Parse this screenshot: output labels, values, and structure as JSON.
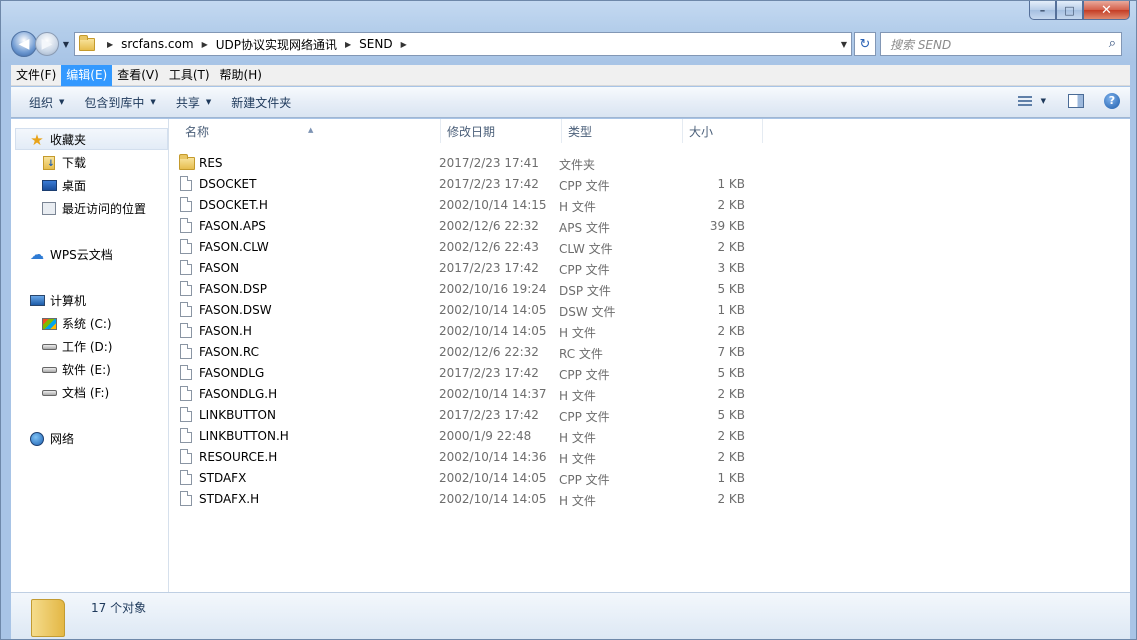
{
  "caption": {
    "min": "–",
    "max": "□",
    "close": "✕"
  },
  "address": {
    "crumbs": [
      "srcfans.com",
      "UDP协议实现网络通讯",
      "SEND"
    ],
    "search_placeholder": "搜索 SEND"
  },
  "menu": [
    "文件(F)",
    "编辑(E)",
    "查看(V)",
    "工具(T)",
    "帮助(H)"
  ],
  "toolbar": {
    "organize": "组织",
    "include": "包含到库中",
    "share": "共享",
    "new_folder": "新建文件夹"
  },
  "nav": {
    "favorites": "收藏夹",
    "downloads": "下载",
    "desktop": "桌面",
    "recent": "最近访问的位置",
    "wps": "WPS云文档",
    "computer": "计算机",
    "drive_c": "系统 (C:)",
    "drive_d": "工作 (D:)",
    "drive_e": "软件 (E:)",
    "drive_f": "文档 (F:)",
    "network": "网络"
  },
  "columns": {
    "name": "名称",
    "date": "修改日期",
    "type": "类型",
    "size": "大小"
  },
  "files": [
    {
      "name": "RES",
      "date": "2017/2/23 17:41",
      "type": "文件夹",
      "size": "",
      "folder": true
    },
    {
      "name": "DSOCKET",
      "date": "2017/2/23 17:42",
      "type": "CPP 文件",
      "size": "1 KB"
    },
    {
      "name": "DSOCKET.H",
      "date": "2002/10/14 14:15",
      "type": "H 文件",
      "size": "2 KB"
    },
    {
      "name": "FASON.APS",
      "date": "2002/12/6 22:32",
      "type": "APS 文件",
      "size": "39 KB"
    },
    {
      "name": "FASON.CLW",
      "date": "2002/12/6 22:43",
      "type": "CLW 文件",
      "size": "2 KB"
    },
    {
      "name": "FASON",
      "date": "2017/2/23 17:42",
      "type": "CPP 文件",
      "size": "3 KB"
    },
    {
      "name": "FASON.DSP",
      "date": "2002/10/16 19:24",
      "type": "DSP 文件",
      "size": "5 KB"
    },
    {
      "name": "FASON.DSW",
      "date": "2002/10/14 14:05",
      "type": "DSW 文件",
      "size": "1 KB"
    },
    {
      "name": "FASON.H",
      "date": "2002/10/14 14:05",
      "type": "H 文件",
      "size": "2 KB"
    },
    {
      "name": "FASON.RC",
      "date": "2002/12/6 22:32",
      "type": "RC 文件",
      "size": "7 KB"
    },
    {
      "name": "FASONDLG",
      "date": "2017/2/23 17:42",
      "type": "CPP 文件",
      "size": "5 KB"
    },
    {
      "name": "FASONDLG.H",
      "date": "2002/10/14 14:37",
      "type": "H 文件",
      "size": "2 KB"
    },
    {
      "name": "LINKBUTTON",
      "date": "2017/2/23 17:42",
      "type": "CPP 文件",
      "size": "5 KB"
    },
    {
      "name": "LINKBUTTON.H",
      "date": "2000/1/9 22:48",
      "type": "H 文件",
      "size": "2 KB"
    },
    {
      "name": "RESOURCE.H",
      "date": "2002/10/14 14:36",
      "type": "H 文件",
      "size": "2 KB"
    },
    {
      "name": "STDAFX",
      "date": "2002/10/14 14:05",
      "type": "CPP 文件",
      "size": "1 KB"
    },
    {
      "name": "STDAFX.H",
      "date": "2002/10/14 14:05",
      "type": "H 文件",
      "size": "2 KB"
    }
  ],
  "status": {
    "count": "17 个对象"
  }
}
